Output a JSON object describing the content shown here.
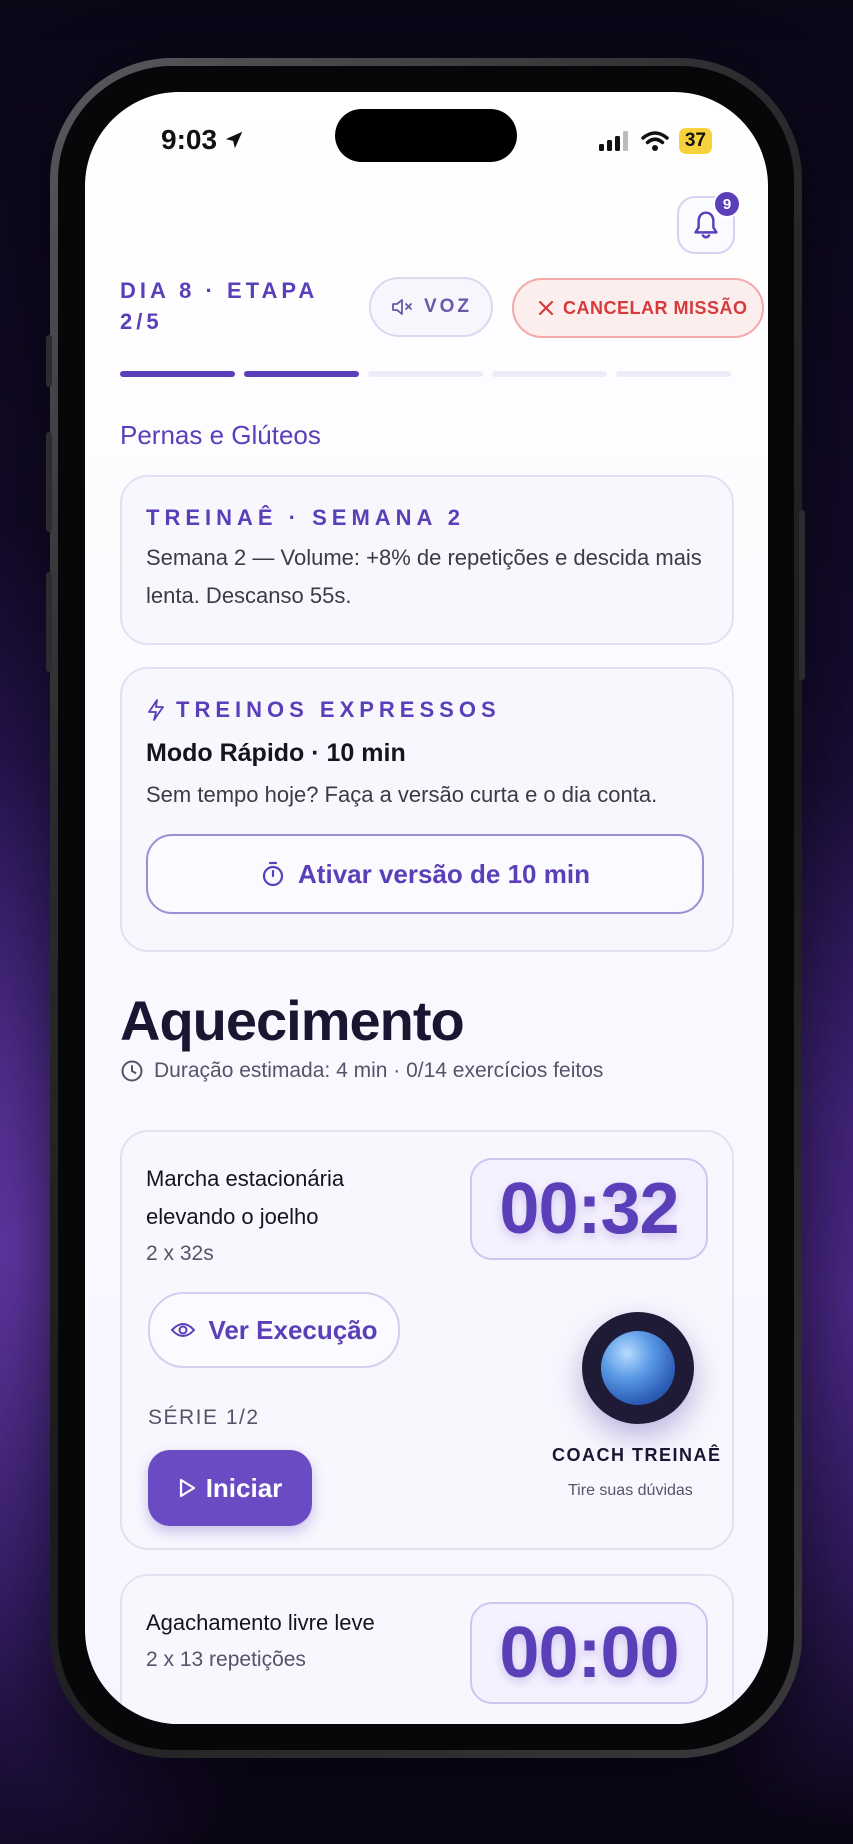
{
  "status_bar": {
    "time": "9:03",
    "battery": "37"
  },
  "notifications": {
    "count": "9"
  },
  "header": {
    "day_stage": "DIA 8 · ETAPA 2/5",
    "voice_label": "VOZ",
    "cancel_label": "CANCELAR MISSÃO",
    "progress": {
      "completed_steps": 2,
      "total_steps": 5
    }
  },
  "workout_title": "Pernas e Glúteos",
  "week_card": {
    "kicker": "TREINAÊ · SEMANA 2",
    "text": "Semana 2 — Volume: +8% de repetições e descida mais lenta. Descanso 55s."
  },
  "express_card": {
    "kicker": "TREINOS EXPRESSOS",
    "title": "Modo Rápido · 10 min",
    "text": "Sem tempo hoje? Faça a versão curta e o dia conta.",
    "button": "Ativar versão de 10 min"
  },
  "section": {
    "title": "Aquecimento",
    "meta": "Duração estimada: 4 min · 0/14 exercícios feitos"
  },
  "exercises": [
    {
      "name": "Marcha estacionária elevando o joelho",
      "sets": "2 x 32s",
      "timer": "00:32",
      "view_button": "Ver Execução",
      "series": "SÉRIE 1/2",
      "start_button": "Iniciar"
    },
    {
      "name": "Agachamento livre leve",
      "sets": "2 x 13 repetições",
      "timer": "00:00"
    }
  ],
  "coach": {
    "name": "COACH TREINAÊ",
    "subtitle": "Tire suas dúvidas"
  },
  "colors": {
    "accent": "#5b3fb8",
    "danger": "#d63a3a",
    "battery": "#f7d23a"
  }
}
